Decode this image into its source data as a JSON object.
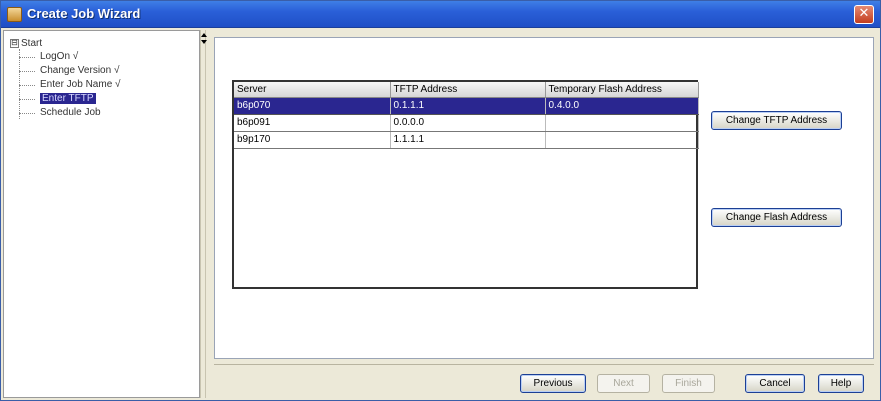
{
  "window": {
    "title": "Create Job Wizard",
    "close_symbol": "✕"
  },
  "tree": {
    "root_label": "Start",
    "toggle_symbol": "⊟",
    "items": [
      {
        "label": "LogOn √",
        "selected": false
      },
      {
        "label": "Change Version √",
        "selected": false
      },
      {
        "label": "Enter Job Name √",
        "selected": false
      },
      {
        "label": "Enter TFTP",
        "selected": true
      },
      {
        "label": "Schedule Job",
        "selected": false
      }
    ]
  },
  "table": {
    "headers": [
      "Server",
      "TFTP Address",
      "Temporary Flash Address"
    ],
    "rows": [
      [
        "b6p070",
        "0.1.1.1",
        "0.4.0.0"
      ],
      [
        "b6p091",
        "0.0.0.0",
        ""
      ],
      [
        "b9p170",
        "1.1.1.1",
        ""
      ]
    ],
    "selected_row": 0
  },
  "actions": {
    "change_tftp": "Change TFTP Address",
    "change_flash": "Change Flash Address"
  },
  "footer": {
    "previous": "Previous",
    "next": "Next",
    "finish": "Finish",
    "cancel": "Cancel",
    "help": "Help"
  },
  "colors": {
    "titlebar": "#2a5fd8",
    "selection": "#2a2690",
    "window_bg": "#ece9d8"
  }
}
